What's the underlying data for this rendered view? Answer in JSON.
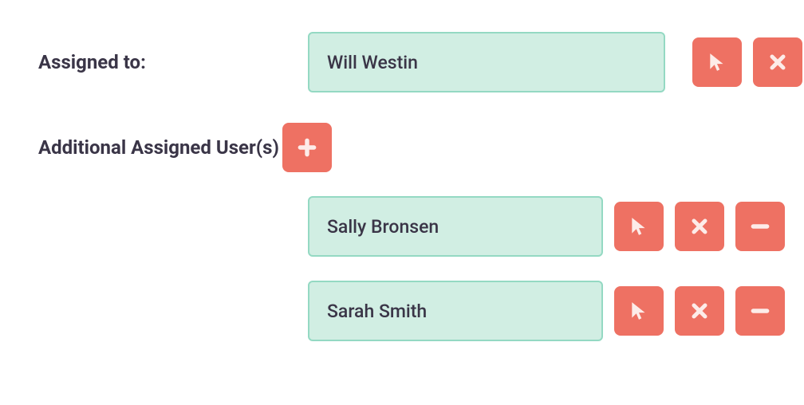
{
  "assigned": {
    "label": "Assigned to:",
    "user": "Will Westin"
  },
  "additional": {
    "label": "Additional Assigned User(s)",
    "users": [
      "Sally Bronsen",
      "Sarah Smith"
    ]
  },
  "colors": {
    "button": "#ee7163",
    "field_bg": "#d1eee3",
    "field_border": "#94d9c3",
    "text": "#3a3547"
  }
}
